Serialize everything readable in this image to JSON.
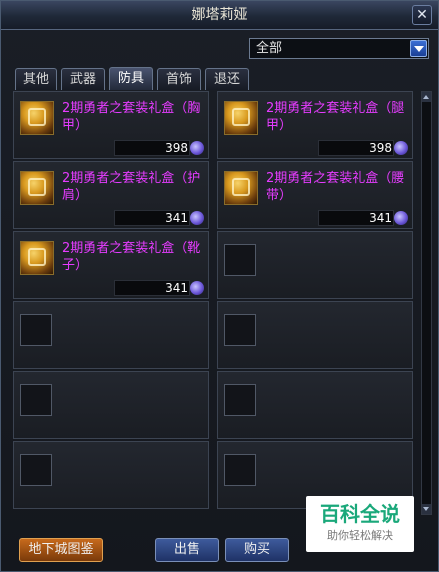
{
  "window": {
    "title": "娜塔莉娅",
    "close_label": "✕"
  },
  "filter": {
    "selected": "全部"
  },
  "tabs": [
    {
      "label": "其他",
      "active": false
    },
    {
      "label": "武器",
      "active": false
    },
    {
      "label": "防具",
      "active": true
    },
    {
      "label": "首饰",
      "active": false
    },
    {
      "label": "退还",
      "active": false
    }
  ],
  "items": [
    {
      "name": "2期勇者之套装礼盒（胸甲）",
      "price": "398"
    },
    {
      "name": "2期勇者之套装礼盒（腿甲）",
      "price": "398"
    },
    {
      "name": "2期勇者之套装礼盒（护肩）",
      "price": "341"
    },
    {
      "name": "2期勇者之套装礼盒（腰带）",
      "price": "341"
    },
    {
      "name": "2期勇者之套装礼盒（靴子）",
      "price": "341"
    }
  ],
  "footer": {
    "dungeon_button": "地下城图鉴",
    "sell_button": "出售",
    "buy_button": "购买"
  },
  "watermark": {
    "title": "百科全说",
    "subtitle": "助你轻松解决"
  },
  "colors": {
    "item_name": "#e63cff",
    "accent": "#3e5b9c",
    "orange": "#c76a1c"
  }
}
